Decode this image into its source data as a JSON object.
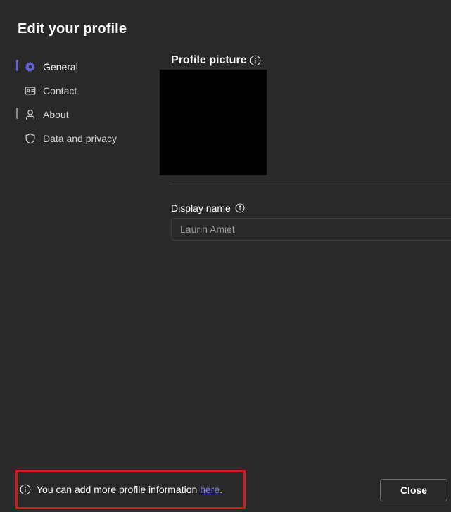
{
  "dialog": {
    "title": "Edit your profile"
  },
  "colors": {
    "accent": "#7f85f5",
    "active_indicator": "#6264d8",
    "highlight_border": "#d3181e"
  },
  "sidebar": {
    "items": [
      {
        "label": "General",
        "icon": "gear-icon",
        "active": true
      },
      {
        "label": "Contact",
        "icon": "contact-card-icon",
        "active": false
      },
      {
        "label": "About",
        "icon": "person-icon",
        "active": false
      },
      {
        "label": "Data and privacy",
        "icon": "shield-icon",
        "active": false
      }
    ]
  },
  "main": {
    "profile_picture": {
      "label": "Profile picture",
      "info_icon": "info-icon"
    },
    "display_name": {
      "label": "Display name",
      "info_icon": "info-icon",
      "value": "",
      "placeholder": "Laurin Amiet"
    }
  },
  "footer": {
    "note_prefix": "You can add more profile information ",
    "note_link": "here",
    "note_suffix": ".",
    "close_label": "Close"
  }
}
